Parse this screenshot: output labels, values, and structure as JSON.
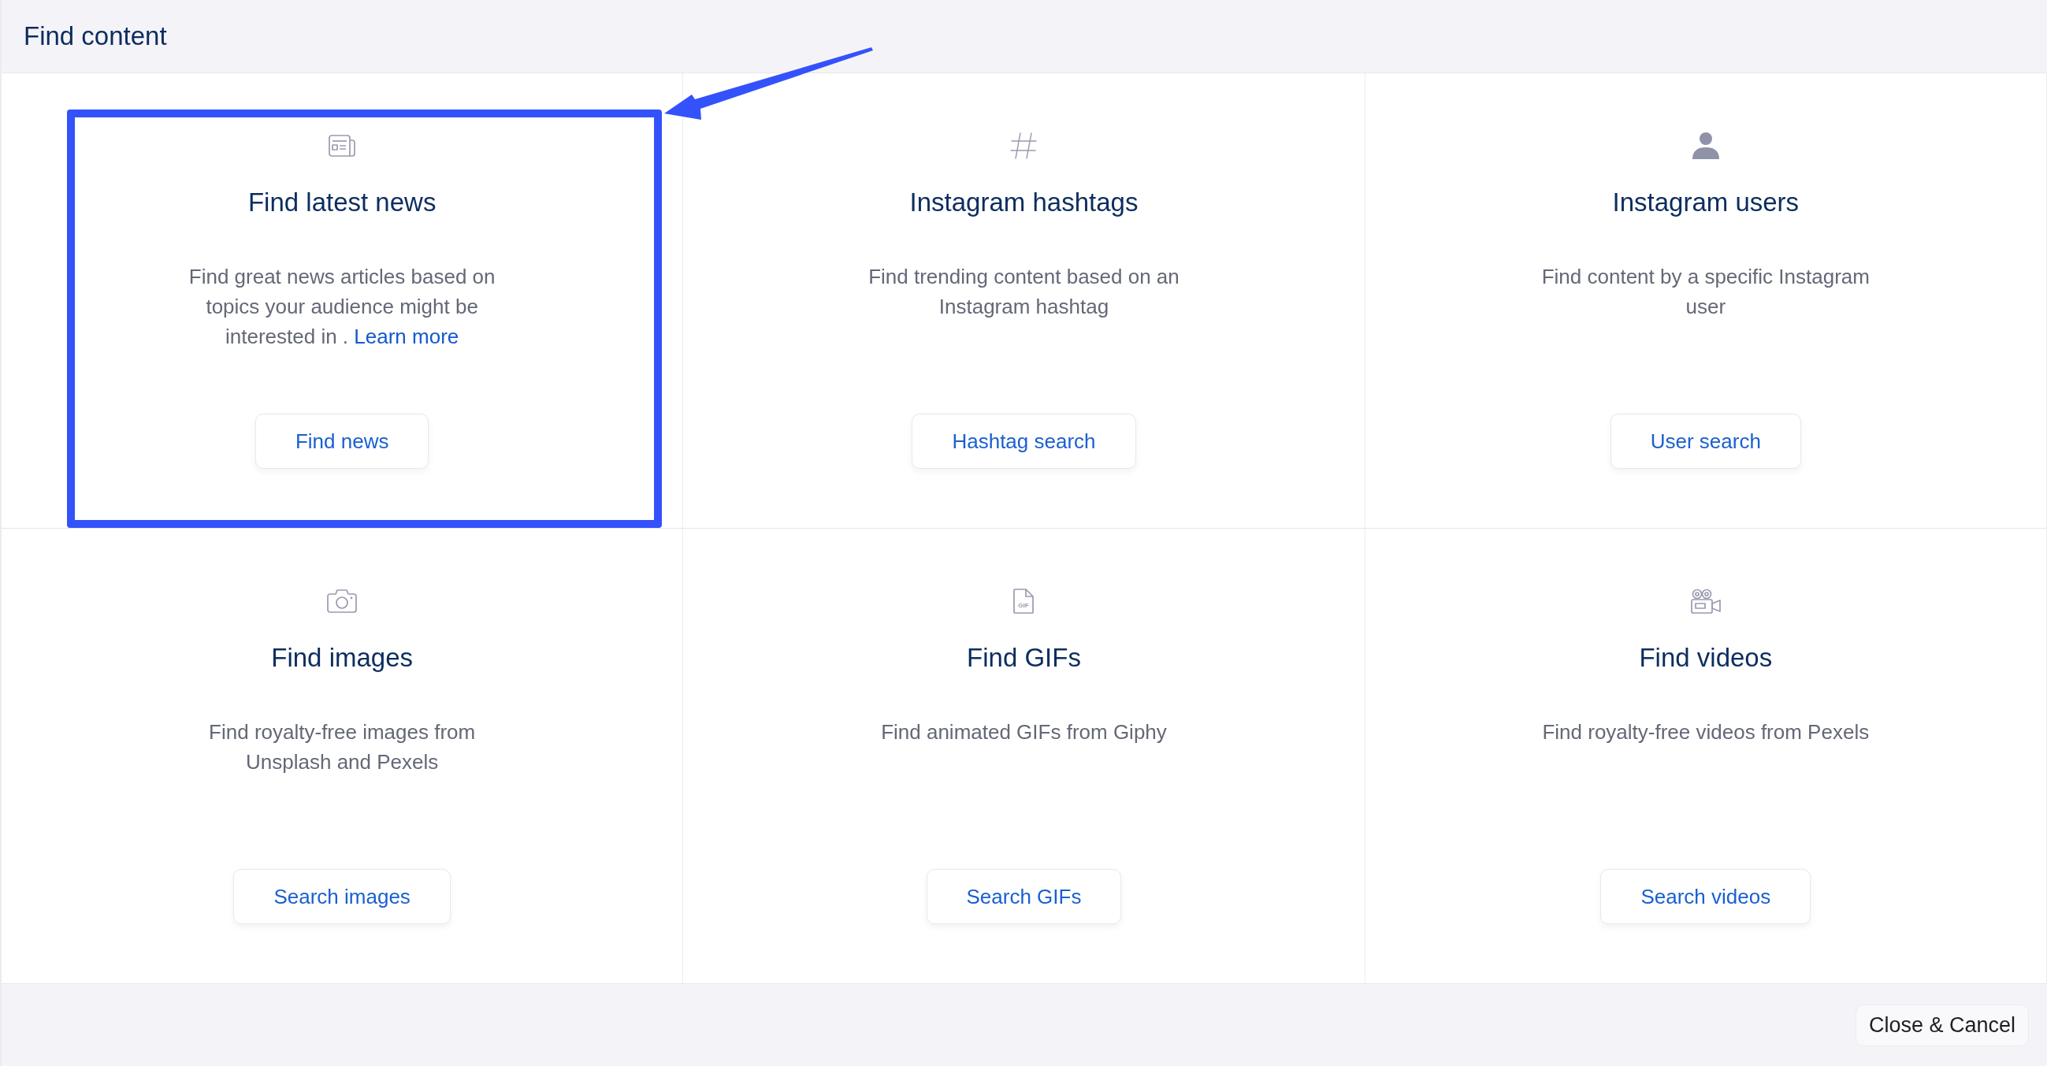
{
  "dialog": {
    "title": "Find content"
  },
  "cards": [
    {
      "title": "Find latest news",
      "description": "Find great news articles based on topics your audience might be interested in .",
      "link": "Learn more",
      "button": "Find news",
      "highlighted": true
    },
    {
      "title": "Instagram hashtags",
      "description": "Find trending content based on an Instagram hashtag",
      "button": "Hashtag search",
      "highlighted": false
    },
    {
      "title": "Instagram users",
      "description": "Find content by a specific Instagram user",
      "button": "User search",
      "highlighted": false
    },
    {
      "title": "Find images",
      "description": "Find royalty-free images from Unsplash and Pexels",
      "button": "Search images",
      "highlighted": false
    },
    {
      "title": "Find GIFs",
      "description": "Find animated GIFs from Giphy",
      "button": "Search GIFs",
      "highlighted": false,
      "icon_text": "GIF"
    },
    {
      "title": "Find videos",
      "description": "Find royalty-free videos from Pexels",
      "button": "Search videos",
      "highlighted": false
    }
  ],
  "footer": {
    "close_button": "Close & Cancel"
  }
}
